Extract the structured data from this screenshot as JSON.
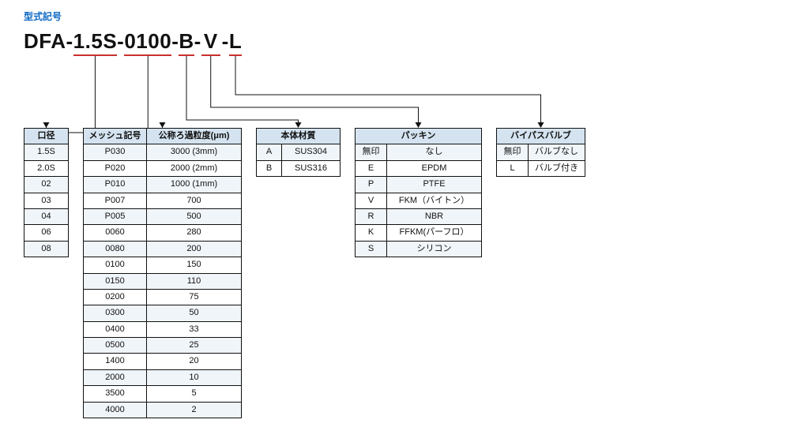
{
  "section_title": "型式記号",
  "model": {
    "prefix": "DFA",
    "dash": "-",
    "seg1": "1.5S",
    "seg2": "0100",
    "seg3": "B",
    "seg4": "V",
    "seg5": "L"
  },
  "tables": {
    "bore": {
      "header": "口径",
      "rows": [
        "1.5S",
        "2.0S",
        "02",
        "03",
        "04",
        "06",
        "08"
      ]
    },
    "mesh": {
      "headers": [
        "メッシュ記号",
        "公称ろ過粒度(μm)"
      ],
      "rows": [
        [
          "P030",
          "3000 (3mm)"
        ],
        [
          "P020",
          "2000 (2mm)"
        ],
        [
          "P010",
          "1000 (1mm)"
        ],
        [
          "P007",
          "700"
        ],
        [
          "P005",
          "500"
        ],
        [
          "0060",
          "280"
        ],
        [
          "0080",
          "200"
        ],
        [
          "0100",
          "150"
        ],
        [
          "0150",
          "110"
        ],
        [
          "0200",
          "75"
        ],
        [
          "0300",
          "50"
        ],
        [
          "0400",
          "33"
        ],
        [
          "0500",
          "25"
        ],
        [
          "1400",
          "20"
        ],
        [
          "2000",
          "10"
        ],
        [
          "3500",
          "5"
        ],
        [
          "4000",
          "2"
        ]
      ]
    },
    "material": {
      "header": "本体材質",
      "rows": [
        [
          "A",
          "SUS304"
        ],
        [
          "B",
          "SUS316"
        ]
      ]
    },
    "packing": {
      "header": "パッキン",
      "rows": [
        [
          "無印",
          "なし"
        ],
        [
          "E",
          "EPDM"
        ],
        [
          "P",
          "PTFE"
        ],
        [
          "V",
          "FKM（バイトン）"
        ],
        [
          "R",
          "NBR"
        ],
        [
          "K",
          "FFKM(パーフロ）"
        ],
        [
          "S",
          "シリコン"
        ]
      ]
    },
    "bypass": {
      "header": "バイパスバルブ",
      "rows": [
        [
          "無印",
          "バルブなし"
        ],
        [
          "L",
          "バルブ付き"
        ]
      ]
    }
  }
}
